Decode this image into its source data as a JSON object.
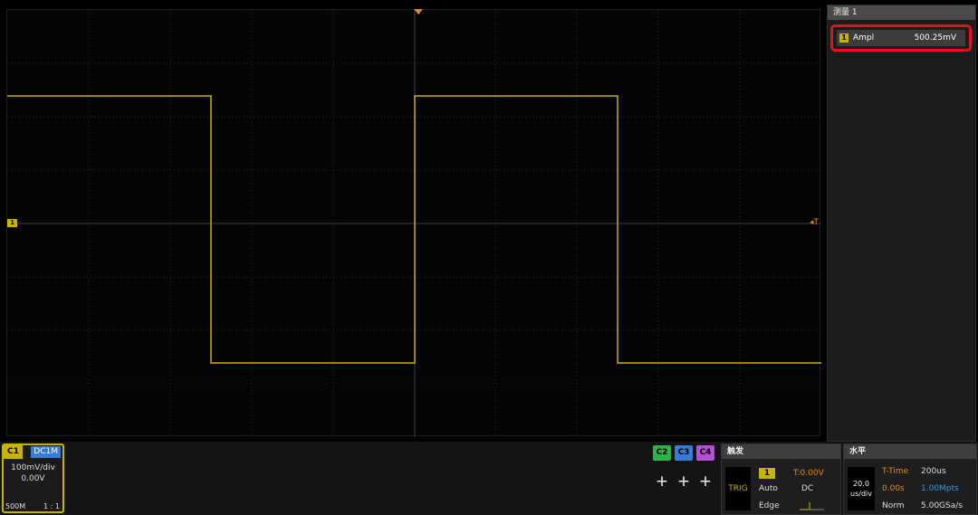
{
  "scope": {
    "channel_marker": "1",
    "trigger_level_marker": "T"
  },
  "measure_panel": {
    "title": "测量 1",
    "item": {
      "channel": "1",
      "name": "Ampl",
      "value": "500.25mV"
    }
  },
  "channel1": {
    "label": "C1",
    "coupling": "DC1M",
    "scale": "100mV/div",
    "offset": "0.00V",
    "bandwidth": "500M",
    "probe": "1 : 1"
  },
  "channel_buttons": [
    {
      "label": "C2",
      "color": "#2db34a"
    },
    {
      "label": "C3",
      "color": "#3a7bd5"
    },
    {
      "label": "C4",
      "color": "#b44fd6"
    }
  ],
  "add_symbol": "+",
  "trigger": {
    "title": "触发",
    "state": "TRIG",
    "source": "1",
    "level": "T:0.00V",
    "mode": "Auto",
    "coupling": "DC",
    "type": "Edge"
  },
  "horizontal": {
    "title": "水平",
    "timebase_value": "20.0",
    "timebase_unit": "us/div",
    "ttime_label": "T-Time",
    "ttime_value": "200us",
    "delay": "0.00s",
    "memory": "1.00Mpts",
    "acq_mode": "Norm",
    "sample_rate": "5.00GSa/s"
  },
  "colors": {
    "ch1": "#c8b400",
    "trigger": "#e08a1e",
    "highlight": "#e0141a",
    "memory": "#3a9ad9"
  }
}
